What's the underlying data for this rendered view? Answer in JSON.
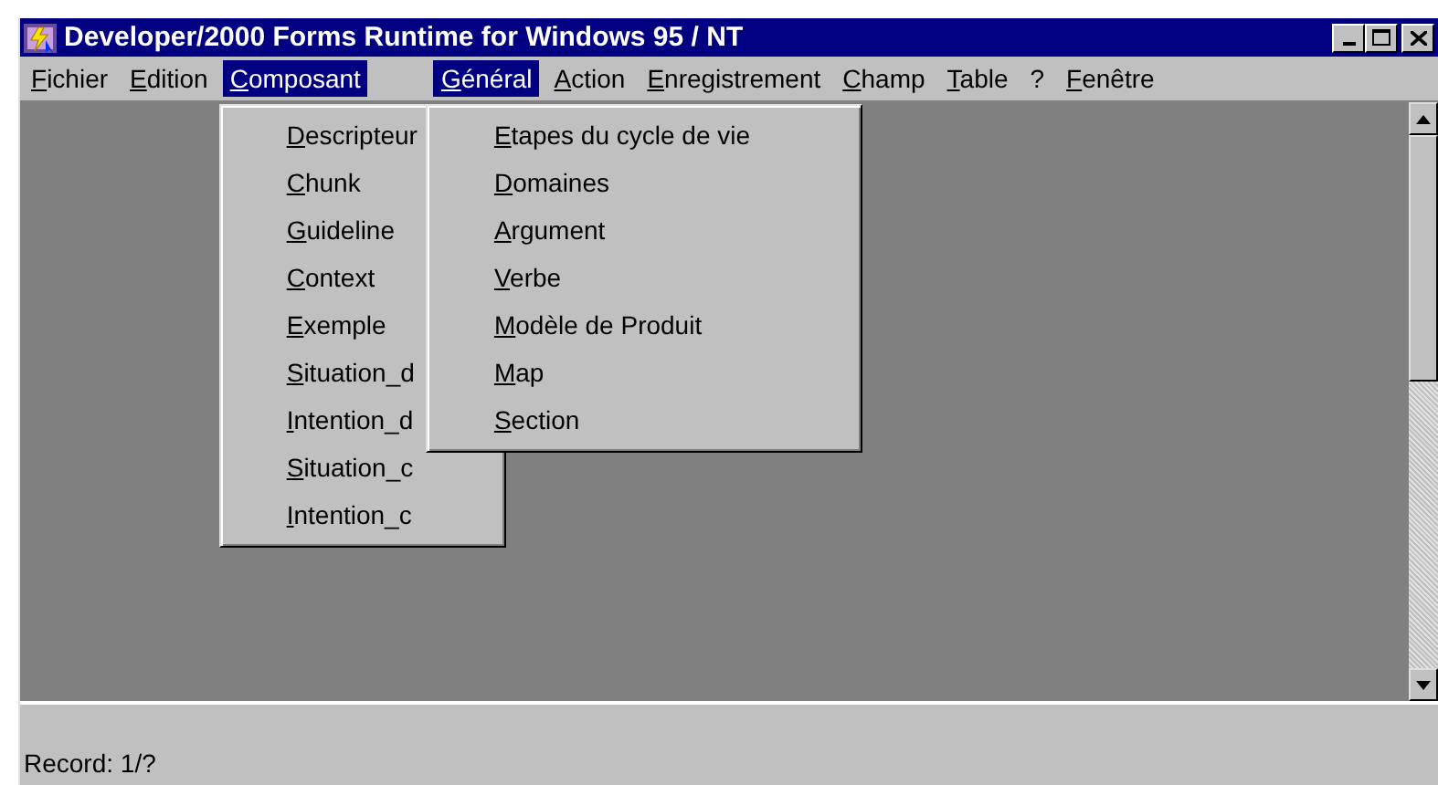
{
  "window": {
    "title": "Developer/2000 Forms Runtime for Windows 95 / NT"
  },
  "menu_bar": [
    {
      "label": "Fichier",
      "selected": false
    },
    {
      "label": "Edition",
      "selected": false
    },
    {
      "label": "Composant",
      "selected": true,
      "items": [
        "Descripteur",
        "Chunk",
        "Guideline",
        "Context",
        "Exemple",
        "Situation_d",
        "Intention_d",
        "Situation_c",
        "Intention_c"
      ]
    },
    {
      "label": "Général",
      "selected": true,
      "items": [
        "Etapes du cycle de vie",
        "Domaines",
        "Argument",
        "Verbe",
        "Modèle de Produit",
        "Map",
        "Section"
      ]
    },
    {
      "label": "Action",
      "selected": false
    },
    {
      "label": "Enregistrement",
      "selected": false
    },
    {
      "label": "Champ",
      "selected": false
    },
    {
      "label": "Table",
      "selected": false
    },
    {
      "label": "?",
      "selected": false
    },
    {
      "label": "Fenêtre",
      "selected": false
    }
  ],
  "status_bar": {
    "text": "Record: 1/?"
  }
}
